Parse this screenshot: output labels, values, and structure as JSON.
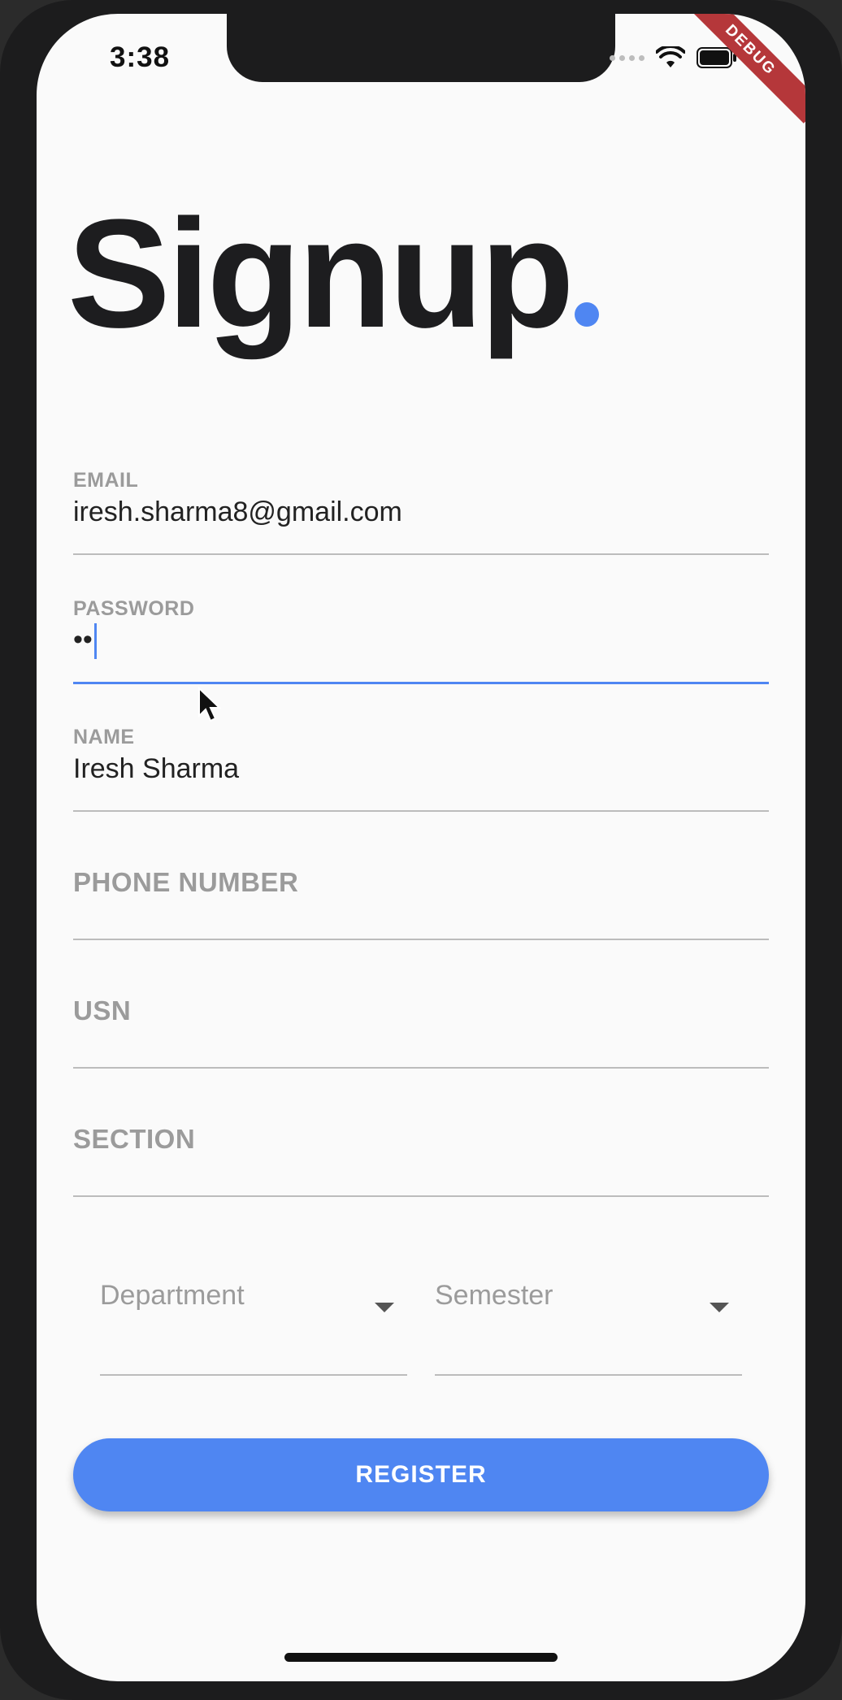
{
  "status_bar": {
    "time": "3:38",
    "icons": [
      "signal-dots-icon",
      "wifi-icon",
      "battery-icon"
    ]
  },
  "debug_banner": "DEBUG",
  "title": "Signup",
  "colors": {
    "accent": "#4f86f2",
    "background": "#fafafa",
    "debug": "#b5373a"
  },
  "fields": {
    "email": {
      "label": "EMAIL",
      "value": "iresh.sharma8@gmail.com"
    },
    "password": {
      "label": "PASSWORD",
      "value": "••"
    },
    "name": {
      "label": "NAME",
      "value": "Iresh Sharma"
    },
    "phone": {
      "label": "PHONE NUMBER"
    },
    "usn": {
      "label": "USN"
    },
    "section": {
      "label": "SECTION"
    }
  },
  "dropdowns": {
    "department": {
      "label": "Department"
    },
    "semester": {
      "label": "Semester"
    }
  },
  "register_label": "REGISTER"
}
